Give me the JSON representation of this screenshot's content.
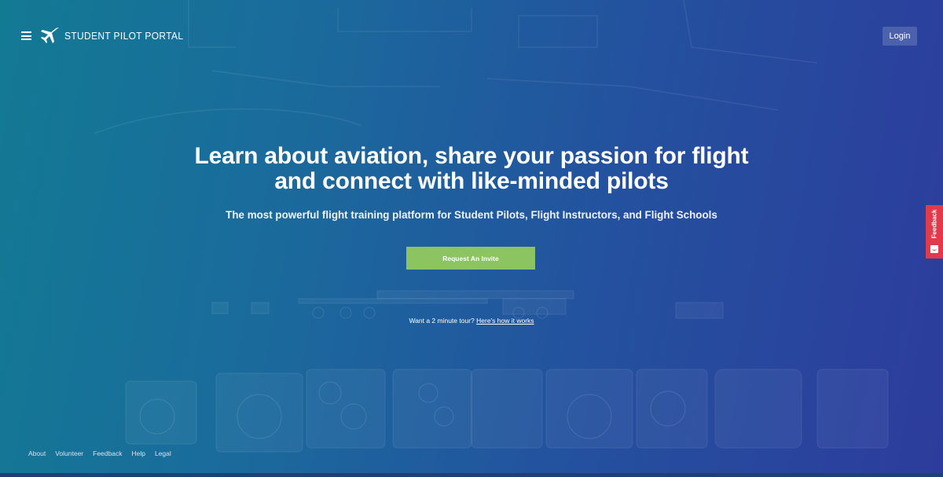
{
  "header": {
    "menu_icon": "hamburger-menu-icon",
    "logo_icon": "airplane-icon",
    "brand": "STUDENT PILOT PORTAL",
    "login_label": "Login"
  },
  "hero": {
    "headline_line1": "Learn about aviation, share your passion for flight",
    "headline_line2": "and connect with like-minded pilots",
    "subheadline": "The most powerful flight training platform for Student Pilots, Flight Instructors, and Flight Schools",
    "cta_label": "Request An Invite",
    "tour_text": "Want a 2 minute tour?",
    "tour_link": "Here's how it works"
  },
  "footer": {
    "links": [
      "About",
      "Volunteer",
      "Feedback",
      "Help",
      "Legal"
    ]
  },
  "feedback_tab": {
    "label": "Feedback",
    "icon": "smile-icon"
  },
  "colors": {
    "gradient_left": "#137a94",
    "gradient_right": "#2d3c9c",
    "cta": "#8cc461",
    "feedback": "#e23a4d"
  }
}
